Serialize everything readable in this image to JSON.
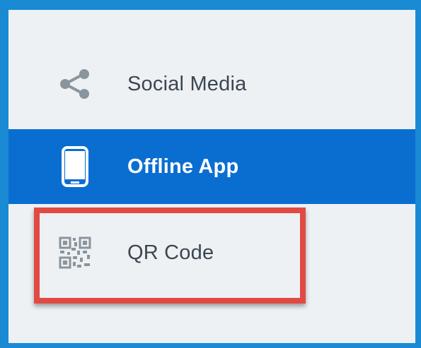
{
  "menu": {
    "items": [
      {
        "label": "Social Media",
        "icon": "share-icon",
        "selected": false
      },
      {
        "label": "Offline App",
        "icon": "tablet-icon",
        "selected": true
      },
      {
        "label": "QR Code",
        "icon": "qr-code-icon",
        "selected": false
      }
    ]
  },
  "colors": {
    "frame_border": "#1a8ad4",
    "panel_background": "#eef1f4",
    "selected_background": "#0a6ed1",
    "selected_text": "#ffffff",
    "text": "#3c4650",
    "icon": "#8a949c",
    "highlight_border": "#e04a43"
  }
}
